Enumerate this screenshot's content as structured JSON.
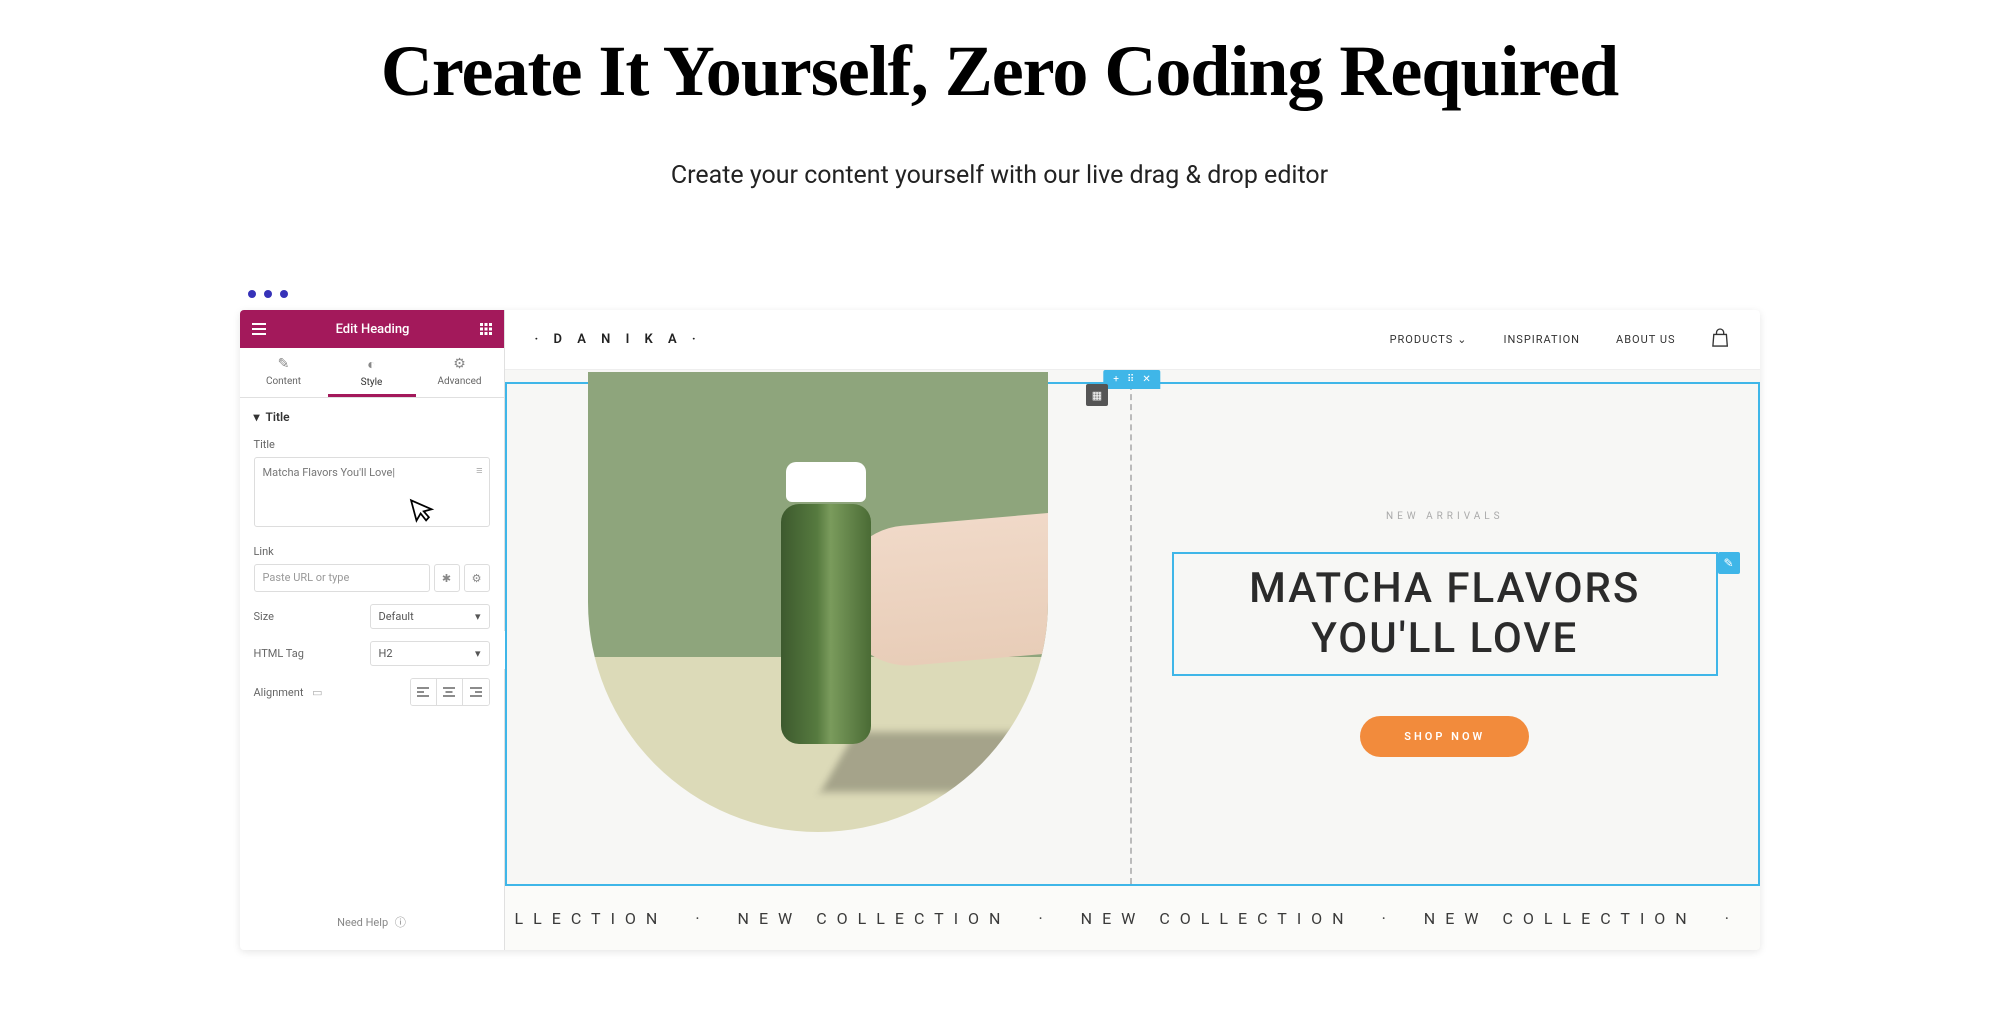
{
  "hero": {
    "title": "Create It Yourself, Zero Coding Required",
    "subtitle": "Create your content yourself with our live drag & drop editor"
  },
  "sidebar": {
    "header_title": "Edit Heading",
    "tabs": {
      "content": "Content",
      "style": "Style",
      "advanced": "Advanced"
    },
    "section_title": "Title",
    "title_field_label": "Title",
    "title_value": "Matcha Flavors You'll Love|",
    "link_label": "Link",
    "link_placeholder": "Paste URL or type",
    "size_label": "Size",
    "size_value": "Default",
    "html_tag_label": "HTML Tag",
    "html_tag_value": "H2",
    "alignment_label": "Alignment",
    "need_help": "Need Help"
  },
  "preview": {
    "brand": "· D A N I K A ·",
    "nav": {
      "products": "PRODUCTS",
      "inspiration": "INSPIRATION",
      "about": "ABOUT US"
    },
    "eyebrow": "NEW ARRIVALS",
    "heading": "MATCHA FLAVORS YOU'LL LOVE",
    "cta": "SHOP NOW",
    "marquee_item": "NEW COLLECTION",
    "marquee_partial_start": "LLECTION",
    "marquee_partial_end": "NEW CO"
  }
}
